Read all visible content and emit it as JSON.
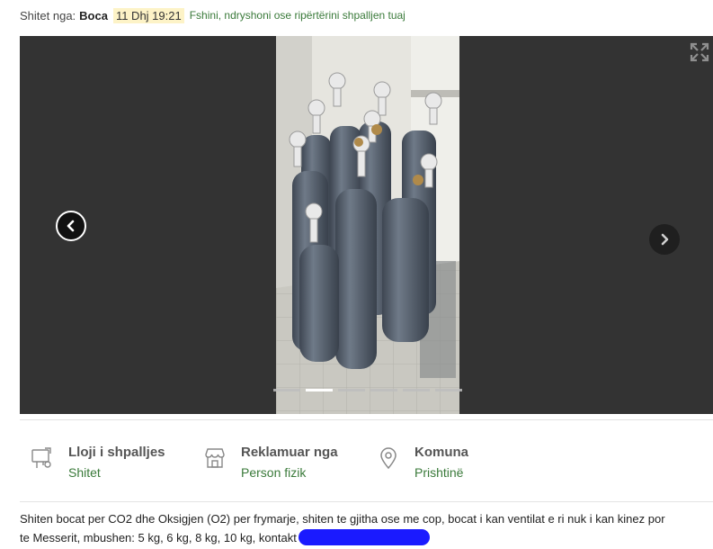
{
  "header": {
    "seller_label": "Shitet nga:",
    "seller_name": "Boca",
    "date": "11 Dhj 19:21",
    "edit_link": "Fshini, ndryshoni ose ripërtërini shpalljen tuaj"
  },
  "gallery": {
    "slide_count": 6,
    "active_slide": 2,
    "photo_alt": "Gas cylinders"
  },
  "info": [
    {
      "label": "Lloji i shpalljes",
      "value": "Shitet",
      "icon": "listing-type-icon"
    },
    {
      "label": "Reklamuar nga",
      "value": "Person fizik",
      "icon": "shop-icon"
    },
    {
      "label": "Komuna",
      "value": "Prishtinë",
      "icon": "location-pin-icon"
    }
  ],
  "description": {
    "line1": "Shiten bocat per CO2 dhe Oksigjen (O2) per frymarje, shiten te gjitha ose me cop, bocat i kan ventilat e ri nuk i kan kinez por",
    "line2": "te Messerit, mbushen: 5 kg, 6 kg, 8 kg, 10 kg, kontakt"
  },
  "colors": {
    "accent_green": "#3a7a3a",
    "date_highlight": "#fdf3c7",
    "redaction": "#1a1aff"
  }
}
